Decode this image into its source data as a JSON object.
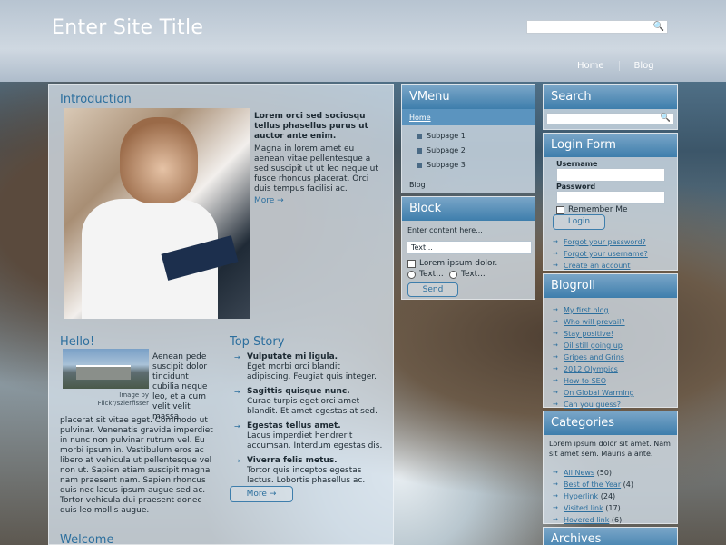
{
  "site": {
    "title": "Enter Site Title"
  },
  "nav": {
    "items": [
      "Home",
      "Blog"
    ]
  },
  "intro": {
    "heading": "Introduction",
    "bold": "Lorem orci sed sociosqu tellus phasellus purus ut auctor ante enim.",
    "text": "Magna in lorem amet eu aenean vitae pellentesque a sed suscipit ut ut leo neque ut fusce rhoncus placerat. Orci duis tempus facilisi ac.",
    "more": "More →"
  },
  "hello": {
    "heading": "Hello!",
    "side_text": "Aenean pede suscipit dolor tincidunt cubilia neque leo, et a cum velit velit massa",
    "caption": "Image by Flickr/szierfisser",
    "text": "placerat sit vitae eget. Commodo ut pulvinar. Venenatis gravida imperdiet in nunc non pulvinar rutrum vel. Eu morbi ipsum in. Vestibulum eros ac libero at vehicula ut pellentesque vel non ut. Sapien etiam suscipit magna nam praesent nam. Sapien rhoncus quis nec lacus ipsum augue sed ac. Tortor vehicula dui praesent donec quis leo mollis augue."
  },
  "top_story": {
    "heading": "Top Story",
    "items": [
      {
        "title": "Vulputate mi ligula.",
        "text": "Eget morbi orci blandit adipiscing. Feugiat quis integer."
      },
      {
        "title": "Sagittis quisque nunc.",
        "text": "Curae turpis eget orci amet blandit. Et amet egestas at sed."
      },
      {
        "title": "Egestas tellus amet.",
        "text": "Lacus imperdiet hendrerit accumsan. Interdum egestas dis."
      },
      {
        "title": "Viverra felis metus.",
        "text": "Tortor quis inceptos egestas lectus. Lobortis phasellus ac."
      }
    ],
    "more": "More →"
  },
  "welcome": {
    "heading": "Welcome"
  },
  "vmenu": {
    "heading": "VMenu",
    "home": "Home",
    "subpages": [
      "Subpage 1",
      "Subpage 2",
      "Subpage 3"
    ],
    "blog": "Blog"
  },
  "block": {
    "heading": "Block",
    "label": "Enter content here...",
    "text_value": "Text...",
    "checkbox": "Lorem ipsum dolor.",
    "radio1": "Text...",
    "radio2": "Text...",
    "send": "Send"
  },
  "search": {
    "heading": "Search"
  },
  "login": {
    "heading": "Login Form",
    "username": "Username",
    "password": "Password",
    "remember": "Remember Me",
    "login_btn": "Login",
    "forgot_password": "Forgot your password?",
    "forgot_username": "Forgot your username?",
    "create": "Create an account"
  },
  "blogroll": {
    "heading": "Blogroll",
    "items": [
      "My first blog",
      "Who will prevail?",
      "Stay positive!",
      "Oil still going up",
      "Gripes and Grins",
      "2012 Olympics",
      "How to SEO",
      "On Global Warming",
      "Can you guess?"
    ]
  },
  "categories": {
    "heading": "Categories",
    "intro": "Lorem ipsum dolor sit amet. Nam sit amet sem. Mauris a ante.",
    "items": [
      {
        "name": "All News",
        "count": "(50)"
      },
      {
        "name": "Best of the Year",
        "count": "(4)"
      },
      {
        "name": "Hyperlink",
        "count": "(24)"
      },
      {
        "name": "Visited link",
        "count": "(17)"
      },
      {
        "name": "Hovered link",
        "count": "(6)"
      }
    ]
  },
  "archives": {
    "heading": "Archives"
  },
  "icons": {
    "search": "search-icon",
    "bird": "bird-icon"
  }
}
